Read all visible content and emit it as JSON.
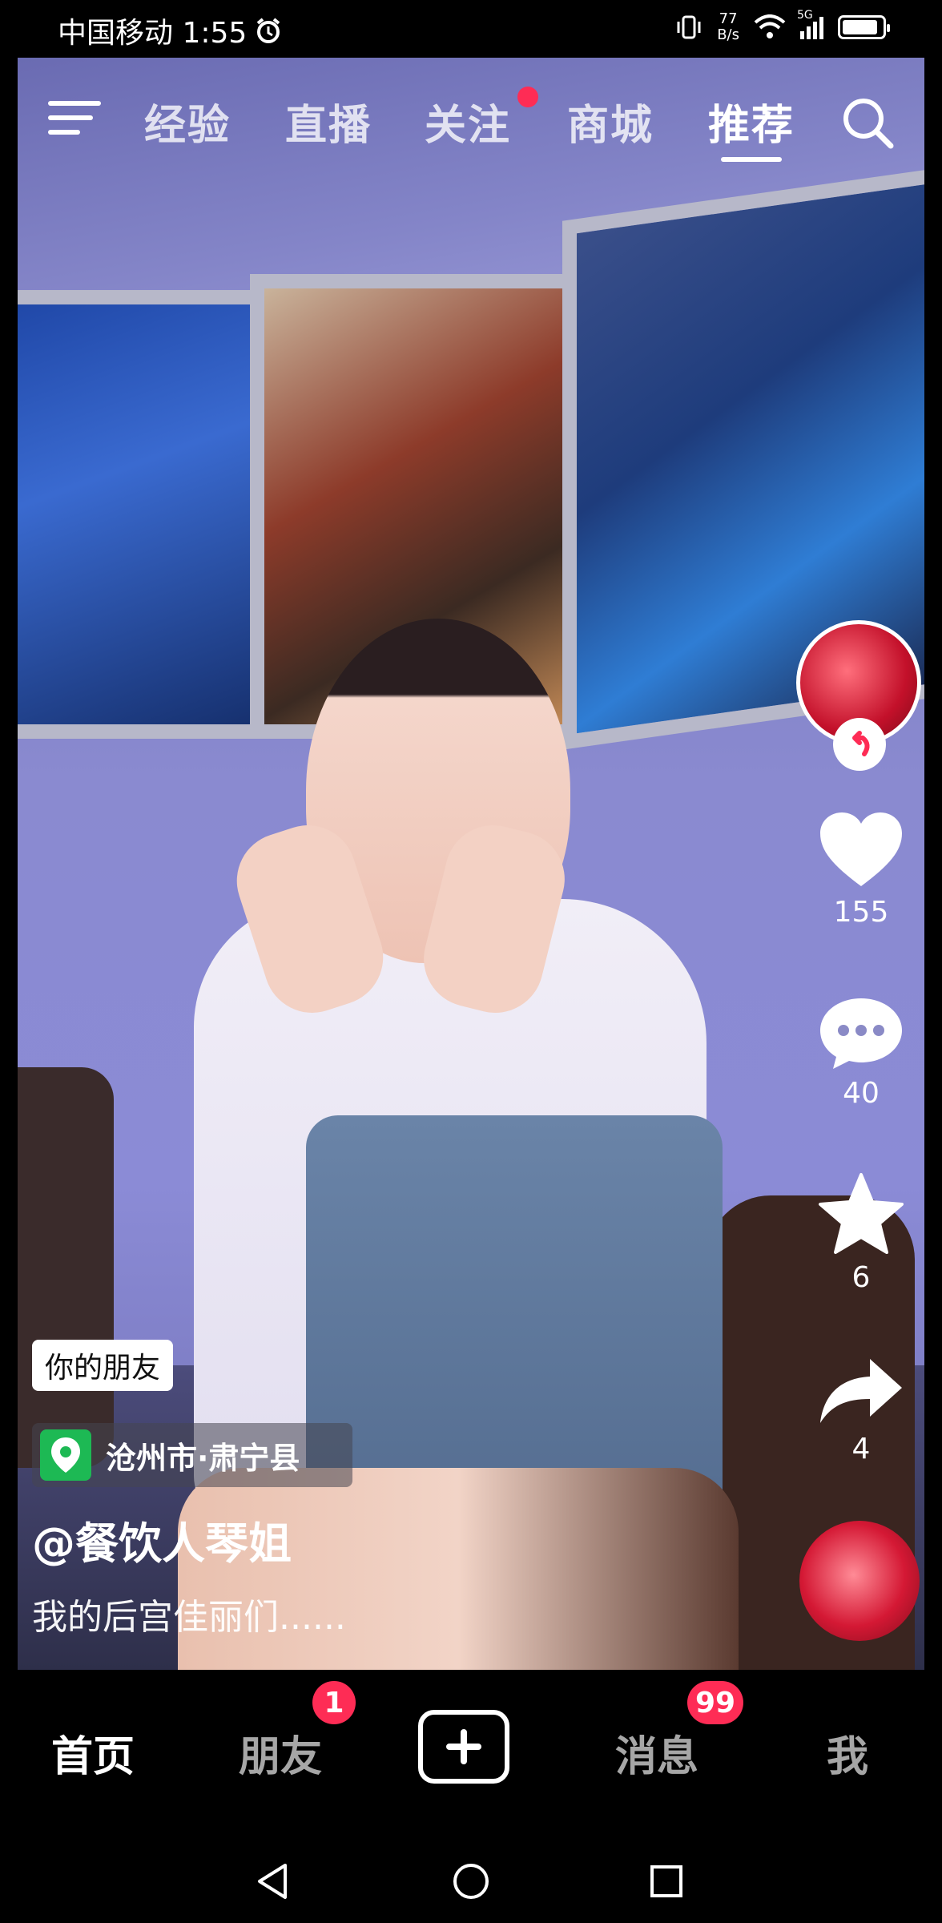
{
  "status_bar": {
    "carrier_time": "中国移动 1:55",
    "net_speed_top": "77",
    "net_speed_bottom": "B/s",
    "network_gen": "5G",
    "battery_level_percent": 90
  },
  "top_nav": {
    "tabs": [
      "经验",
      "直播",
      "关注",
      "商城",
      "推荐"
    ],
    "active_tab": "推荐",
    "follow_tab_has_dot": true
  },
  "right_rail": {
    "likes": "155",
    "comments": "40",
    "favorites": "6",
    "shares": "4"
  },
  "overlay": {
    "friend_tag": "你的朋友",
    "location": "沧州市·肃宁县",
    "username": "@餐饮人琴姐",
    "description": "我的后宫佳丽们......"
  },
  "bottom_tabs": {
    "home": "首页",
    "friends": "朋友",
    "friends_badge": "1",
    "messages": "消息",
    "messages_badge": "99",
    "me": "我"
  },
  "colors": {
    "accent": "#fe2c55",
    "location_icon_bg": "#1db954"
  }
}
